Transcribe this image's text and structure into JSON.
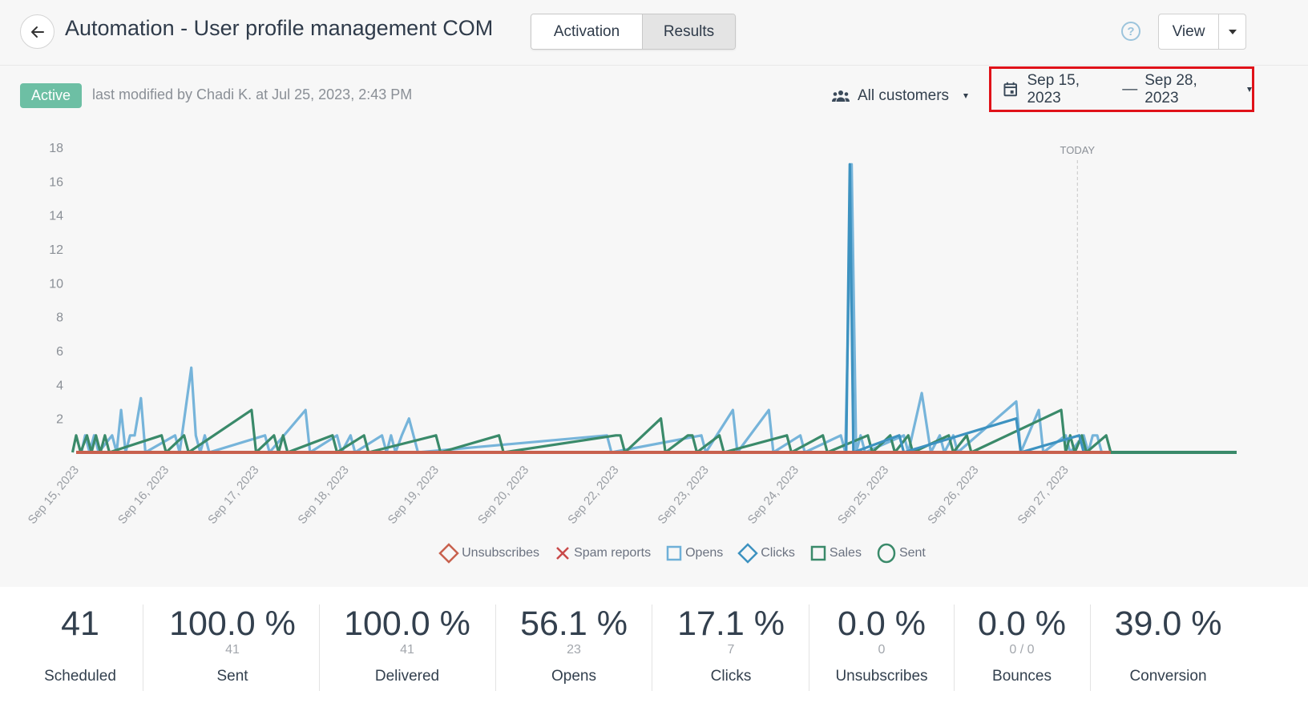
{
  "header": {
    "title": "Automation - User profile management COM",
    "tabs": [
      {
        "label": "Activation",
        "active": false
      },
      {
        "label": "Results",
        "active": true
      }
    ],
    "help_icon": "question-circle-icon",
    "view_label": "View"
  },
  "status": {
    "badge": "Active",
    "badge_color": "#6dbfa4",
    "modified_text": "last modified by Chadi K. at Jul 25, 2023, 2:43 PM"
  },
  "filters": {
    "audience": "All customers",
    "date_start": "Sep 15, 2023",
    "date_separator": "—",
    "date_end": "Sep 28, 2023",
    "highlight_color": "#e01219"
  },
  "chart_data": {
    "type": "line",
    "title": "",
    "xlabel": "",
    "ylabel": "",
    "ylim": [
      0,
      18
    ],
    "yticks": [
      2,
      4,
      6,
      8,
      10,
      12,
      14,
      16,
      18
    ],
    "x_tick_labels": [
      "Sep 15, 2023",
      "Sep 16, 2023",
      "Sep 17, 2023",
      "Sep 18, 2023",
      "Sep 19, 2023",
      "Sep 20, 2023",
      "Sep 22, 2023",
      "Sep 23, 2023",
      "Sep 24, 2023",
      "Sep 25, 2023",
      "Sep 26, 2023",
      "Sep 27, 2023"
    ],
    "today_label": "TODAY",
    "x_domain_days": [
      0,
      12.9
    ],
    "today_at_day": 11.13,
    "grid": false,
    "legend": {
      "position": "bottom",
      "entries": [
        {
          "name": "Unsubscribes",
          "marker": "diamond",
          "color": "#c8614e"
        },
        {
          "name": "Spam reports",
          "marker": "x",
          "color": "#c94a4a"
        },
        {
          "name": "Opens",
          "marker": "square",
          "color": "#6fb0d8"
        },
        {
          "name": "Clicks",
          "marker": "diamond",
          "color": "#3d92c0"
        },
        {
          "name": "Sales",
          "marker": "square",
          "color": "#3a8a6a"
        },
        {
          "name": "Sent",
          "marker": "circle",
          "color": "#3a8a6a"
        }
      ]
    },
    "series": [
      {
        "name": "Opens",
        "color": "#6fb0d8",
        "points": [
          [
            0.1,
            1
          ],
          [
            0.15,
            0
          ],
          [
            0.2,
            1
          ],
          [
            0.25,
            0
          ],
          [
            0.4,
            1
          ],
          [
            0.45,
            0
          ],
          [
            0.5,
            2.5
          ],
          [
            0.55,
            0
          ],
          [
            0.6,
            1
          ],
          [
            0.65,
            1
          ],
          [
            0.72,
            3.2
          ],
          [
            0.77,
            0
          ],
          [
            1.1,
            1
          ],
          [
            1.15,
            0
          ],
          [
            1.28,
            5
          ],
          [
            1.33,
            1
          ],
          [
            1.38,
            0
          ],
          [
            1.43,
            1
          ],
          [
            1.48,
            0
          ],
          [
            2.1,
            1
          ],
          [
            2.15,
            0
          ],
          [
            2.55,
            2.5
          ],
          [
            2.6,
            0
          ],
          [
            2.9,
            1
          ],
          [
            2.95,
            0
          ],
          [
            3.05,
            1
          ],
          [
            3.1,
            0
          ],
          [
            3.4,
            1
          ],
          [
            3.45,
            0
          ],
          [
            3.5,
            1
          ],
          [
            3.55,
            0
          ],
          [
            3.62,
            1
          ],
          [
            3.7,
            2
          ],
          [
            3.8,
            0
          ],
          [
            5.9,
            1
          ],
          [
            5.95,
            0
          ],
          [
            6.95,
            1
          ],
          [
            7.0,
            0
          ],
          [
            7.3,
            2.5
          ],
          [
            7.35,
            0
          ],
          [
            7.7,
            2.5
          ],
          [
            7.75,
            0
          ],
          [
            8.05,
            1
          ],
          [
            8.1,
            0
          ],
          [
            8.5,
            1
          ],
          [
            8.55,
            0
          ],
          [
            8.62,
            17
          ],
          [
            8.67,
            0
          ],
          [
            8.72,
            1
          ],
          [
            8.77,
            0
          ],
          [
            9.2,
            1
          ],
          [
            9.25,
            0
          ],
          [
            9.4,
            3.5
          ],
          [
            9.5,
            0
          ],
          [
            9.6,
            1
          ],
          [
            9.65,
            0
          ],
          [
            9.75,
            1
          ],
          [
            9.8,
            0
          ],
          [
            10.45,
            3
          ],
          [
            10.5,
            0
          ],
          [
            10.7,
            2.5
          ],
          [
            10.75,
            0
          ],
          [
            11.0,
            1
          ],
          [
            11.05,
            0
          ],
          [
            11.2,
            1
          ],
          [
            11.25,
            0
          ],
          [
            11.3,
            1
          ],
          [
            11.35,
            1
          ],
          [
            11.4,
            0
          ]
        ]
      },
      {
        "name": "Clicks",
        "color": "#3d92c0",
        "points": [
          [
            8.6,
            17
          ],
          [
            8.64,
            0
          ],
          [
            9.15,
            1
          ],
          [
            9.2,
            0
          ],
          [
            10.45,
            2
          ],
          [
            10.5,
            0
          ],
          [
            11.15,
            1
          ],
          [
            11.2,
            0
          ]
        ]
      },
      {
        "name": "Sales",
        "color": "#3a8a6a",
        "points": [
          [
            0.0,
            1
          ],
          [
            0.05,
            0
          ],
          [
            0.12,
            1
          ],
          [
            0.17,
            0
          ],
          [
            0.22,
            1
          ],
          [
            0.27,
            0
          ],
          [
            0.32,
            1
          ],
          [
            0.37,
            0
          ],
          [
            0.95,
            1
          ],
          [
            1.0,
            0
          ],
          [
            1.2,
            1
          ],
          [
            1.25,
            0
          ],
          [
            1.95,
            2.5
          ],
          [
            2.0,
            0
          ],
          [
            2.2,
            1
          ],
          [
            2.25,
            0
          ],
          [
            2.3,
            1
          ],
          [
            2.35,
            0
          ],
          [
            2.85,
            1
          ],
          [
            2.9,
            0
          ],
          [
            3.2,
            1
          ],
          [
            3.25,
            0
          ],
          [
            4.0,
            1
          ],
          [
            4.05,
            0
          ],
          [
            4.7,
            1
          ],
          [
            4.75,
            0
          ],
          [
            6.0,
            1
          ],
          [
            6.05,
            1
          ],
          [
            6.1,
            0
          ],
          [
            6.5,
            2
          ],
          [
            6.55,
            0
          ],
          [
            6.8,
            1
          ],
          [
            6.85,
            1
          ],
          [
            6.9,
            0
          ],
          [
            7.15,
            1
          ],
          [
            7.2,
            0
          ],
          [
            7.9,
            1
          ],
          [
            7.95,
            0
          ],
          [
            8.3,
            1
          ],
          [
            8.35,
            0
          ],
          [
            8.8,
            1
          ],
          [
            8.85,
            0
          ],
          [
            9.05,
            1
          ],
          [
            9.1,
            0
          ],
          [
            9.25,
            1
          ],
          [
            9.3,
            0
          ],
          [
            9.7,
            1
          ],
          [
            9.75,
            0
          ],
          [
            9.9,
            1
          ],
          [
            9.95,
            0
          ],
          [
            10.95,
            2.5
          ],
          [
            11.0,
            0
          ],
          [
            11.05,
            1
          ],
          [
            11.1,
            0
          ],
          [
            11.18,
            1
          ],
          [
            11.23,
            0
          ],
          [
            11.45,
            1
          ],
          [
            11.5,
            0
          ]
        ]
      },
      {
        "name": "Sent",
        "color": "#3a8a6a",
        "points": [
          [
            0,
            0
          ],
          [
            12.9,
            0
          ]
        ]
      },
      {
        "name": "Unsubscribes",
        "color": "#c8614e",
        "points": [
          [
            0,
            0
          ],
          [
            11.5,
            0
          ]
        ]
      }
    ]
  },
  "stats": [
    {
      "value": "41",
      "sub": "",
      "label": "Scheduled"
    },
    {
      "value": "100.0 %",
      "sub": "41",
      "label": "Sent"
    },
    {
      "value": "100.0 %",
      "sub": "41",
      "label": "Delivered"
    },
    {
      "value": "56.1 %",
      "sub": "23",
      "label": "Opens"
    },
    {
      "value": "17.1 %",
      "sub": "7",
      "label": "Clicks"
    },
    {
      "value": "0.0 %",
      "sub": "0",
      "label": "Unsubscribes"
    },
    {
      "value": "0.0 %",
      "sub": "0 / 0",
      "label": "Bounces"
    },
    {
      "value": "39.0 %",
      "sub": "",
      "label": "Conversion"
    }
  ]
}
